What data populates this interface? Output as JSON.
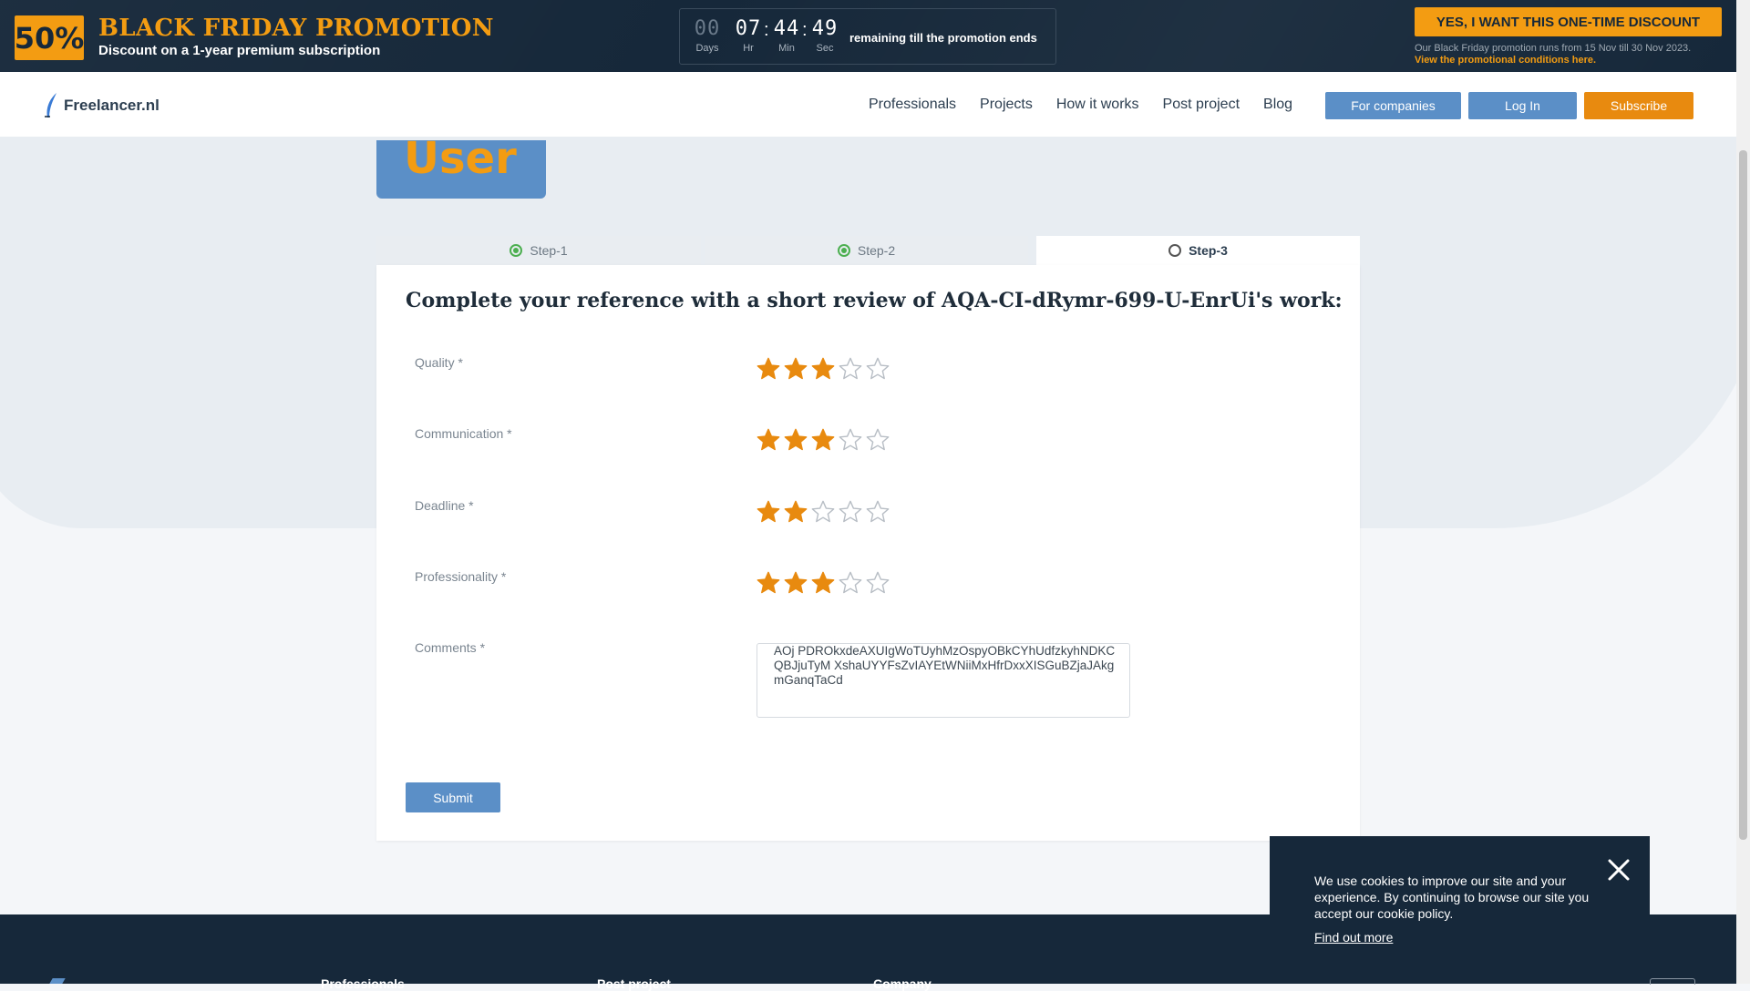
{
  "promo": {
    "badge": "50%",
    "title": "BLACK FRIDAY PROMOTION",
    "subtitle": "Discount on a 1-year premium subscription",
    "countdown": {
      "days": "00",
      "hours": "07",
      "minutes": "44",
      "seconds": "49",
      "days_label": "Days",
      "hours_label": "Hr",
      "minutes_label": "Min",
      "seconds_label": "Sec",
      "text": "remaining till the promotion ends"
    },
    "cta": "YES, I WANT THIS ONE-TIME DISCOUNT",
    "note": "Our Black Friday promotion runs from 15 Nov till 30 Nov 2023.",
    "conditions_link": "View the promotional conditions here."
  },
  "nav": {
    "logo": "Freelancer.nl",
    "links": [
      "Professionals",
      "Projects",
      "How it works",
      "Post project",
      "Blog"
    ],
    "for_companies": "For companies",
    "login": "Log In",
    "subscribe": "Subscribe"
  },
  "avatar": {
    "text": "User"
  },
  "tabs": [
    {
      "label": "Step-1",
      "status": "done"
    },
    {
      "label": "Step-2",
      "status": "done"
    },
    {
      "label": "Step-3",
      "status": "current"
    }
  ],
  "form": {
    "title": "Complete your reference with a short review of AQA-CI-dRymr-699-U-EnrUi's work:",
    "ratings": [
      {
        "label": "Quality *",
        "value": 3,
        "max": 5
      },
      {
        "label": "Communication *",
        "value": 3,
        "max": 5
      },
      {
        "label": "Deadline *",
        "value": 2,
        "max": 5
      },
      {
        "label": "Professionality *",
        "value": 3,
        "max": 5
      }
    ],
    "comments_label": "Comments *",
    "comments_value": "AOj PDROkxdeAXUIgWoTUyhMzOspyOBkCYhUdfzkyhNDKCQBJjuTyM XshaUYYFsZvIAYEtWNiiMxHfrDxxXISGuBZjaJAkgmGanqTaCd",
    "submit": "Submit"
  },
  "footer": {
    "columns": [
      "Professionals",
      "Post project",
      "Company"
    ]
  },
  "cookie": {
    "text": "We use cookies to improve our site and your experience. By continuing to browse our site you accept our cookie policy.",
    "link": "Find out more"
  },
  "colors": {
    "accent": "#f39c12",
    "primary_button": "#5b8fc7",
    "dark_bg": "#16283a",
    "star_filled": "#e88a0f",
    "step_done": "#4caf50"
  }
}
